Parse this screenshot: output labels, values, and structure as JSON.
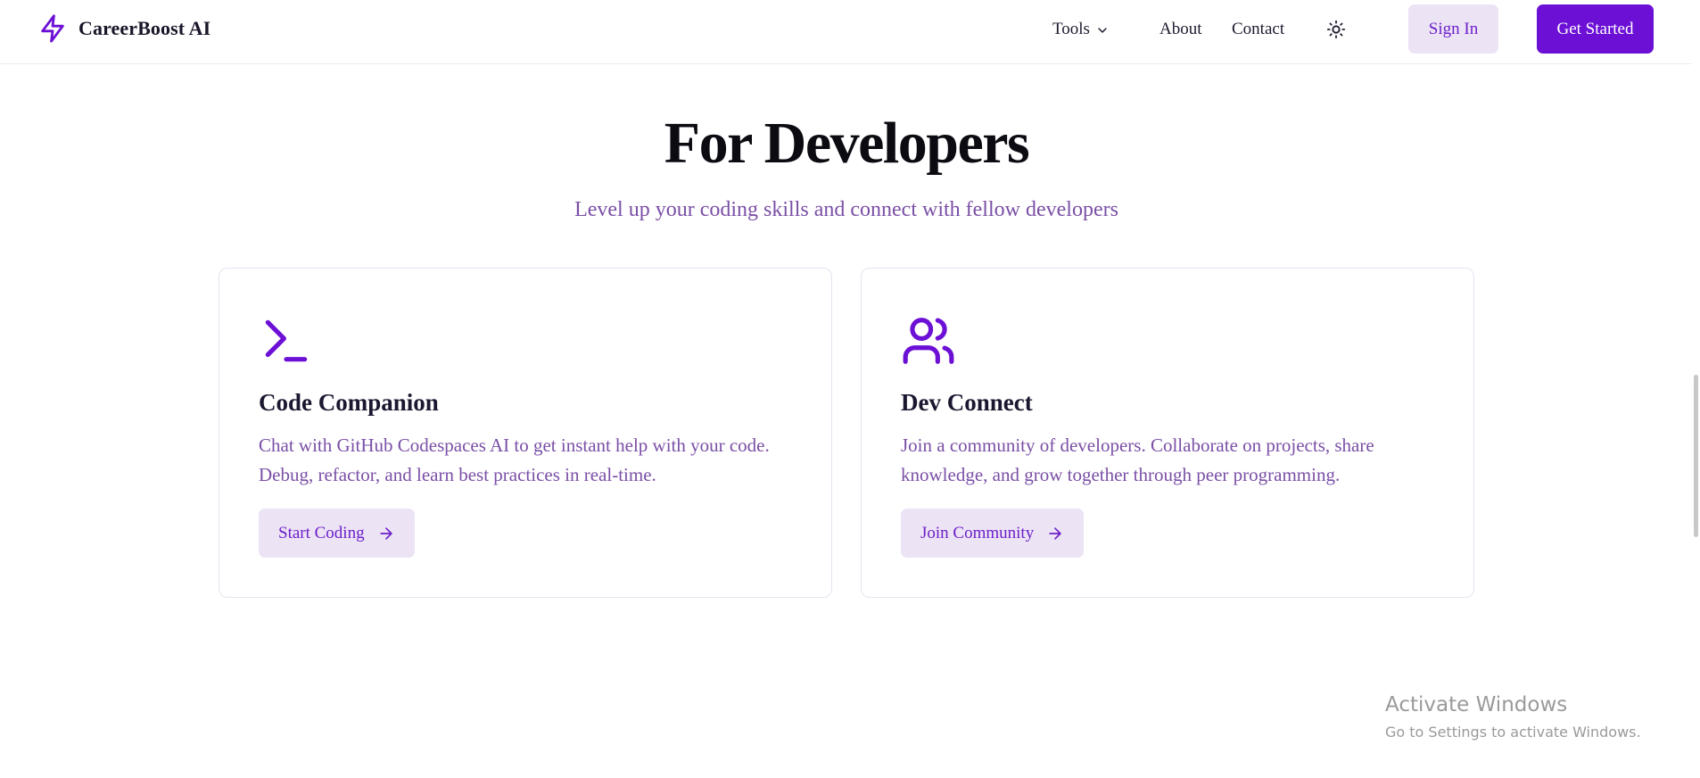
{
  "header": {
    "brand_name": "CareerBoost AI",
    "brand_icon": "lightning-bolt-icon",
    "nav": {
      "tools_label": "Tools",
      "about_label": "About",
      "contact_label": "Contact"
    },
    "theme_icon": "sun-icon",
    "signin_label": "Sign In",
    "get_started_label": "Get Started"
  },
  "section": {
    "title": "For Developers",
    "subtitle": "Level up your coding skills and connect with fellow developers"
  },
  "cards": [
    {
      "icon": "terminal-icon",
      "title": "Code Companion",
      "description": "Chat with GitHub Codespaces AI to get instant help with your code. Debug, refactor, and learn best practices in real-time.",
      "button_label": "Start Coding"
    },
    {
      "icon": "users-icon",
      "title": "Dev Connect",
      "description": "Join a community of developers. Collaborate on projects, share knowledge, and grow together through peer programming.",
      "button_label": "Join Community"
    }
  ],
  "watermark": {
    "title": "Activate Windows",
    "subtitle": "Go to Settings to activate Windows."
  },
  "colors": {
    "accent": "#6c10d6",
    "accent_light": "#ece3f5",
    "muted_text": "#7a4fa6",
    "heading_text": "#0d0b12",
    "border": "#e7e2ee"
  }
}
